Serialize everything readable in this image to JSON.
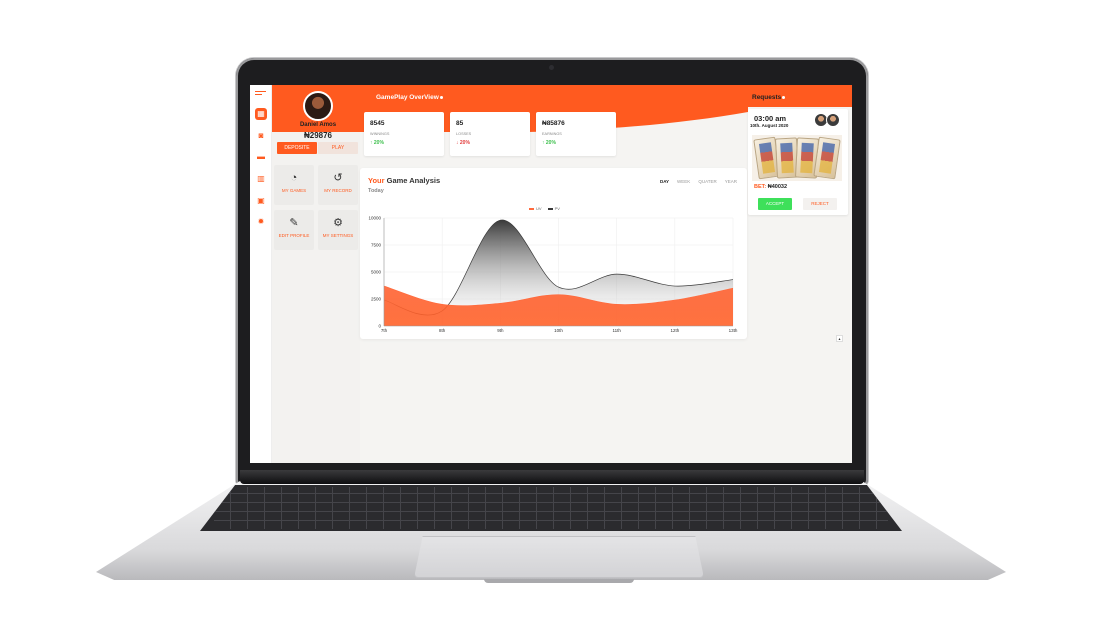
{
  "profile": {
    "name": "Daniel Amos",
    "balance": "₦29876",
    "deposit_label": "DEPOSITE",
    "play_label": "PLAY"
  },
  "quick_actions": [
    {
      "label": "MY GAMES",
      "icon": "gamepad-icon"
    },
    {
      "label": "MY RECORD",
      "icon": "history-icon"
    },
    {
      "label": "EDIT PROFILE",
      "icon": "pencil-icon"
    },
    {
      "label": "MY SETTINGS",
      "icon": "gear-icon"
    }
  ],
  "nav_icons": [
    "menu-icon",
    "dashboard-icon",
    "gamepad-icon",
    "controller-icon",
    "stats-icon",
    "wallet-icon",
    "settings-icon"
  ],
  "overview": {
    "title": "GamePlay OverView",
    "stats": [
      {
        "value": "8545",
        "label": "WINNINGS",
        "change": "20%",
        "direction": "up"
      },
      {
        "value": "85",
        "label": "LOSSES",
        "change": "20%",
        "direction": "down"
      },
      {
        "value": "₦85876",
        "label": "EARNINGS",
        "change": "20%",
        "direction": "up"
      }
    ]
  },
  "analysis": {
    "title_accent": "Your",
    "title_rest": " Game Analysis",
    "subtitle": "Today",
    "tabs": [
      "DAY",
      "WEEK",
      "QUATER",
      "YEAR"
    ],
    "active_tab": "DAY"
  },
  "chart_data": {
    "type": "area",
    "x": [
      "7th",
      "8th",
      "9th",
      "10th",
      "11th",
      "12th",
      "13th"
    ],
    "yticks": [
      "10000",
      "7500",
      "5000",
      "2500",
      "0"
    ],
    "ylim": [
      0,
      10000
    ],
    "series": [
      {
        "name": "UV",
        "color": "#ff6a3d",
        "values": [
          3700,
          2000,
          2100,
          2900,
          2000,
          2400,
          3500
        ]
      },
      {
        "name": "PV",
        "color": "#3a3a3a",
        "values": [
          2400,
          1400,
          9800,
          3600,
          4800,
          3700,
          4300
        ]
      }
    ],
    "grid": true,
    "legend": "top-center"
  },
  "requests": {
    "title": "Requests",
    "time": "03:00 am",
    "date": "10th. August 2020",
    "bet_label": "BET:",
    "bet_value": "₦40032",
    "accept_label": "ACCEPT",
    "reject_label": "REJECT"
  },
  "colors": {
    "accent": "#ff5a1f",
    "positive": "#3bbf4b",
    "negative": "#e23a3a",
    "accept": "#3ee05a"
  }
}
